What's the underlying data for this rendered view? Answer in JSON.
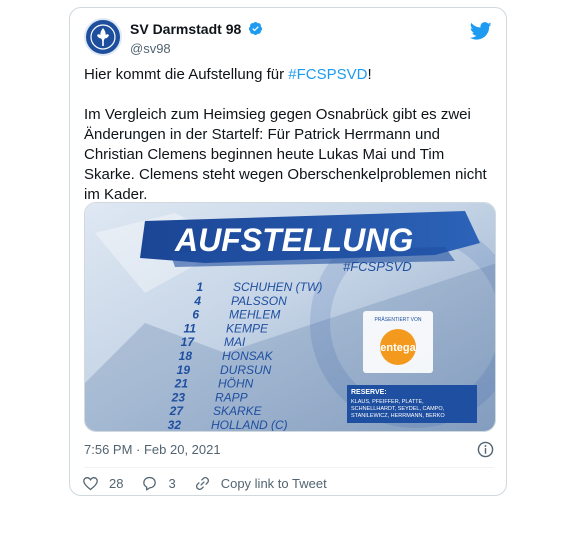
{
  "account": {
    "display_name": "SV Darmstadt 98",
    "handle": "@sv98"
  },
  "tweet": {
    "line1_prefix": "Hier kommt die Aufstellung für ",
    "line1_hashtag": "#FCSPSVD",
    "line1_suffix": "!",
    "paragraph2": "Im Vergleich zum Heimsieg gegen Osnabrück gibt es zwei Änderungen in der Startelf: Für Patrick Herrmann und Christian Clemens beginnen heute Lukas Mai und Tim Skarke. Clemens steht wegen Oberschenkelproblemen nicht im Kader."
  },
  "graphic": {
    "title": "AUFSTELLUNG",
    "hashtag": "#FCSPSVD",
    "players": [
      {
        "number": "1",
        "name": "SCHUHEN (TW)"
      },
      {
        "number": "4",
        "name": "PALSSON"
      },
      {
        "number": "6",
        "name": "MEHLEM"
      },
      {
        "number": "11",
        "name": "KEMPE"
      },
      {
        "number": "17",
        "name": "MAI"
      },
      {
        "number": "18",
        "name": "HONSAK"
      },
      {
        "number": "19",
        "name": "DURSUN"
      },
      {
        "number": "21",
        "name": "HÖHN"
      },
      {
        "number": "23",
        "name": "RAPP"
      },
      {
        "number": "27",
        "name": "SKARKE"
      },
      {
        "number": "32",
        "name": "HOLLAND (C)"
      }
    ],
    "sponsor_caption": "PRÄSENTIERT VON",
    "sponsor_name": "entega",
    "reserve_title": "RESERVE:",
    "reserve_line1": "KLAUS, PFEIFFER, PLATTE,",
    "reserve_line2": "SCHNELLHARDT, SEYDEL, CAMPO,",
    "reserve_line3": "STANILEWICZ, HERRMANN, BERKO"
  },
  "meta": {
    "timestamp": "7:56 PM · Feb 20, 2021"
  },
  "actions": {
    "likes": "28",
    "replies": "3",
    "copy_link": "Copy link to Tweet"
  },
  "colors": {
    "accent": "#1d9bf0",
    "graphic_blue": "#1f4fa0",
    "sponsor_orange": "#f39a1e"
  }
}
